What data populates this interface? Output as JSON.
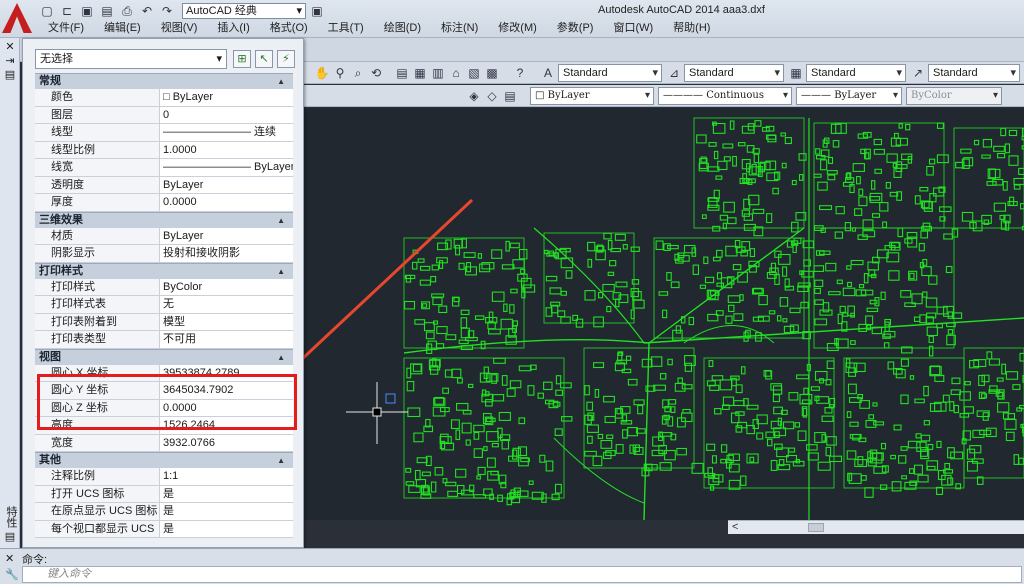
{
  "window": {
    "title": "Autodesk AutoCAD 2014    aaa3.dxf",
    "workspace": "AutoCAD 经典"
  },
  "menubar": [
    "文件(F)",
    "编辑(E)",
    "视图(V)",
    "插入(I)",
    "格式(O)",
    "工具(T)",
    "绘图(D)",
    "标注(N)",
    "修改(M)",
    "参数(P)",
    "窗口(W)",
    "帮助(H)"
  ],
  "toolbar": {
    "text_style": "Standard",
    "dim_style": "Standard",
    "table_style": "Standard",
    "mleader_style": "Standard",
    "color": "ByLayer",
    "linetype": "Continuous",
    "lineweight": "ByLayer",
    "plotstyle": "ByColor"
  },
  "palette": {
    "selection": "无选择",
    "sections": [
      {
        "title": "常规",
        "rows": [
          {
            "name": "颜色",
            "value": "□ ByLayer"
          },
          {
            "name": "图层",
            "value": "0"
          },
          {
            "name": "线型",
            "value": "———————— 连续"
          },
          {
            "name": "线型比例",
            "value": "1.0000"
          },
          {
            "name": "线宽",
            "value": "———————— ByLayer"
          },
          {
            "name": "透明度",
            "value": "ByLayer"
          },
          {
            "name": "厚度",
            "value": "0.0000"
          }
        ]
      },
      {
        "title": "三维效果",
        "rows": [
          {
            "name": "材质",
            "value": "ByLayer"
          },
          {
            "name": "阴影显示",
            "value": "投射和接收阴影"
          }
        ]
      },
      {
        "title": "打印样式",
        "rows": [
          {
            "name": "打印样式",
            "value": "ByColor"
          },
          {
            "name": "打印样式表",
            "value": "无"
          },
          {
            "name": "打印表附着到",
            "value": "模型"
          },
          {
            "name": "打印表类型",
            "value": "不可用"
          }
        ]
      },
      {
        "title": "视图",
        "rows": [
          {
            "name": "圆心 X 坐标",
            "value": "39533874.2789"
          },
          {
            "name": "圆心 Y 坐标",
            "value": "3645034.7902"
          },
          {
            "name": "圆心 Z 坐标",
            "value": "0.0000"
          },
          {
            "name": "高度",
            "value": "1526.2464"
          },
          {
            "name": "宽度",
            "value": "3932.0766"
          }
        ]
      },
      {
        "title": "其他",
        "rows": [
          {
            "name": "注释比例",
            "value": "1:1"
          },
          {
            "name": "打开 UCS 图标",
            "value": "是"
          },
          {
            "name": "在原点显示 UCS 图标",
            "value": "是"
          },
          {
            "name": "每个视口都显示 UCS",
            "value": "是"
          }
        ]
      }
    ]
  },
  "left_rail": {
    "label": "特性"
  },
  "command": {
    "history": "命令:",
    "placeholder": "键入命令"
  },
  "colors": {
    "drawing_lines": "#22e022",
    "canvas_bg": "#212830",
    "highlight": "#e41c1c"
  }
}
